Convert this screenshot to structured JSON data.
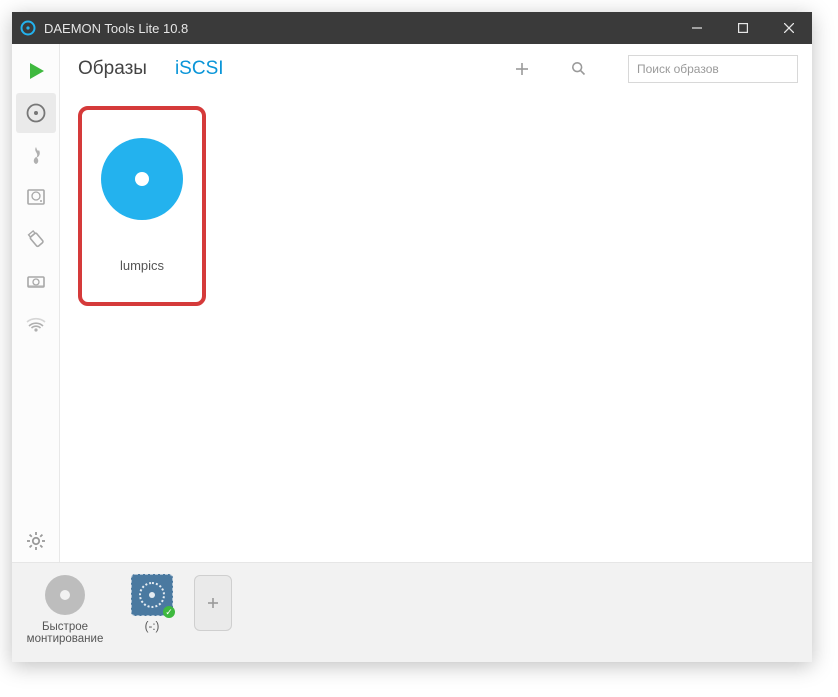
{
  "window": {
    "title": "DAEMON Tools Lite 10.8"
  },
  "tabs": {
    "images": "Образы",
    "iscsi": "iSCSI"
  },
  "search": {
    "placeholder": "Поиск образов"
  },
  "catalog": {
    "items": [
      {
        "label": "lumpics"
      }
    ]
  },
  "drives": {
    "quick_mount": "Быстрое монтирование",
    "virtual_drive": "(-:)"
  },
  "icons": {
    "app": "disc",
    "minimize": "minimize",
    "maximize": "maximize",
    "close": "close",
    "add": "plus",
    "search": "magnifier",
    "settings": "gear"
  },
  "colors": {
    "accent": "#23b2ee",
    "highlight_border": "#d53a3a",
    "mount_green": "#3fb93f"
  }
}
